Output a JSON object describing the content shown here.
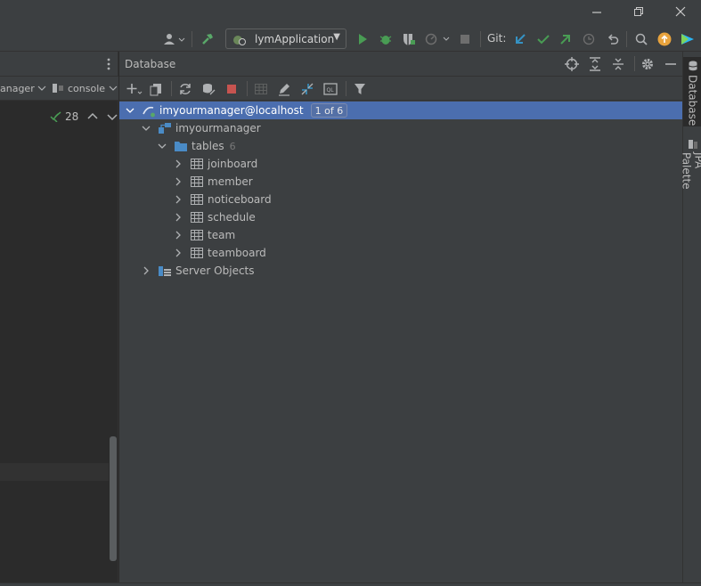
{
  "window": {
    "minimize_glyph": "—",
    "restore_glyph": "❐",
    "close_glyph": "✕"
  },
  "toolbar": {
    "run_config_label": "lymApplication",
    "git_label": "Git:"
  },
  "left_panel": {
    "tab1_label": "anager",
    "tab2_label": "console",
    "check_count": "28"
  },
  "db_panel": {
    "title": "Database"
  },
  "tree": {
    "root_label": "imyourmanager@localhost",
    "root_badge": "1 of 6",
    "schema_label": "imyourmanager",
    "tables_label": "tables",
    "tables_count": "6",
    "tables": [
      "joinboard",
      "member",
      "noticeboard",
      "schedule",
      "team",
      "teamboard"
    ],
    "server_objects_label": "Server Objects"
  },
  "right_stripe": {
    "tab_database": "Database",
    "tab_jpa": "JPA Palette"
  },
  "colors": {
    "selection": "#4b6eaf",
    "run_green": "#499c54",
    "git_blue": "#3592c4",
    "folder_blue": "#4a8bc6",
    "stop_red": "#c75450",
    "update_orange": "#e8a33d"
  }
}
